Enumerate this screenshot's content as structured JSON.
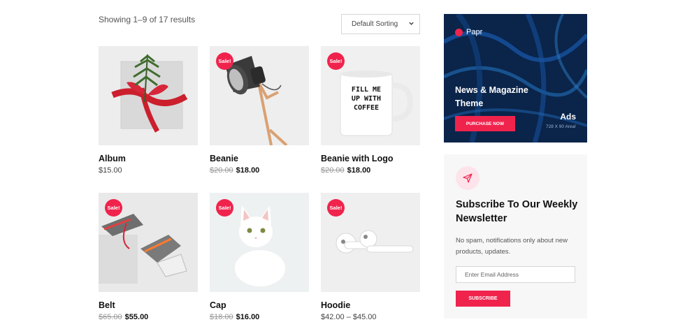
{
  "shop": {
    "result_count": "Showing 1–9 of 17 results",
    "sorting": "Default Sorting"
  },
  "sale_badge": "Sale!",
  "products": [
    {
      "name": "Album",
      "price": "$15.00",
      "old_price": "",
      "sale": false
    },
    {
      "name": "Beanie",
      "price": "$18.00",
      "old_price": "$20.00",
      "sale": true
    },
    {
      "name": "Beanie with Logo",
      "price": "$18.00",
      "old_price": "$20.00",
      "sale": true
    },
    {
      "name": "Belt",
      "price": "$55.00",
      "old_price": "$65.00",
      "sale": true
    },
    {
      "name": "Cap",
      "price": "$16.00",
      "old_price": "$18.00",
      "sale": true
    },
    {
      "name": "Hoodie",
      "price": "$42.00 – $45.00",
      "old_price": "",
      "sale": true
    }
  ],
  "mug_text": "FILL ME UP WITH COFFEE",
  "ad": {
    "logo": "Papr",
    "headline": "News & Magazine Theme",
    "cta": "PURCHASE NOW",
    "label": "Ads",
    "size": "728 X 90 Area!"
  },
  "newsletter": {
    "title": "Subscribe To Our Weekly Newsletter",
    "description": "No spam, notifications only about new products, updates.",
    "email_placeholder": "Enter Email Address",
    "button": "SUBSCRIBE"
  },
  "colors": {
    "accent": "#f0234d",
    "ad_bg": "#0a2a55"
  },
  "icons": [
    "chevron-down-icon",
    "paper-plane-icon",
    "papr-logo-icon"
  ]
}
